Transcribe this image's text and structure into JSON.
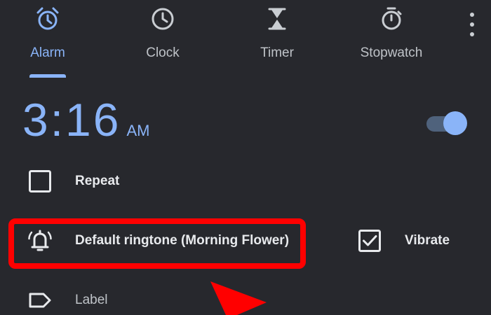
{
  "tabs": [
    {
      "label": "Alarm",
      "icon": "alarm-clock-icon",
      "active": true
    },
    {
      "label": "Clock",
      "icon": "clock-icon",
      "active": false
    },
    {
      "label": "Timer",
      "icon": "hourglass-icon",
      "active": false
    },
    {
      "label": "Stopwatch",
      "icon": "stopwatch-icon",
      "active": false
    }
  ],
  "menu": {
    "icon": "more-vertical-icon"
  },
  "alarm": {
    "time": "3:16",
    "ampm": "AM",
    "enabled": true,
    "repeat": {
      "label": "Repeat",
      "checked": false
    },
    "ringtone": {
      "label": "Default ringtone (Morning Flower)",
      "icon": "bell-ringing-icon"
    },
    "vibrate": {
      "label": "Vibrate",
      "checked": true
    },
    "label_field": {
      "label": "Label",
      "icon": "label-tag-icon"
    }
  },
  "annotation": {
    "highlight_color": "#ff0000",
    "pointer": "red-arrow"
  },
  "colors": {
    "accent": "#8ab4f8",
    "background": "#27282d",
    "text": "#e8eaed",
    "muted_text": "#bfc3c8"
  }
}
